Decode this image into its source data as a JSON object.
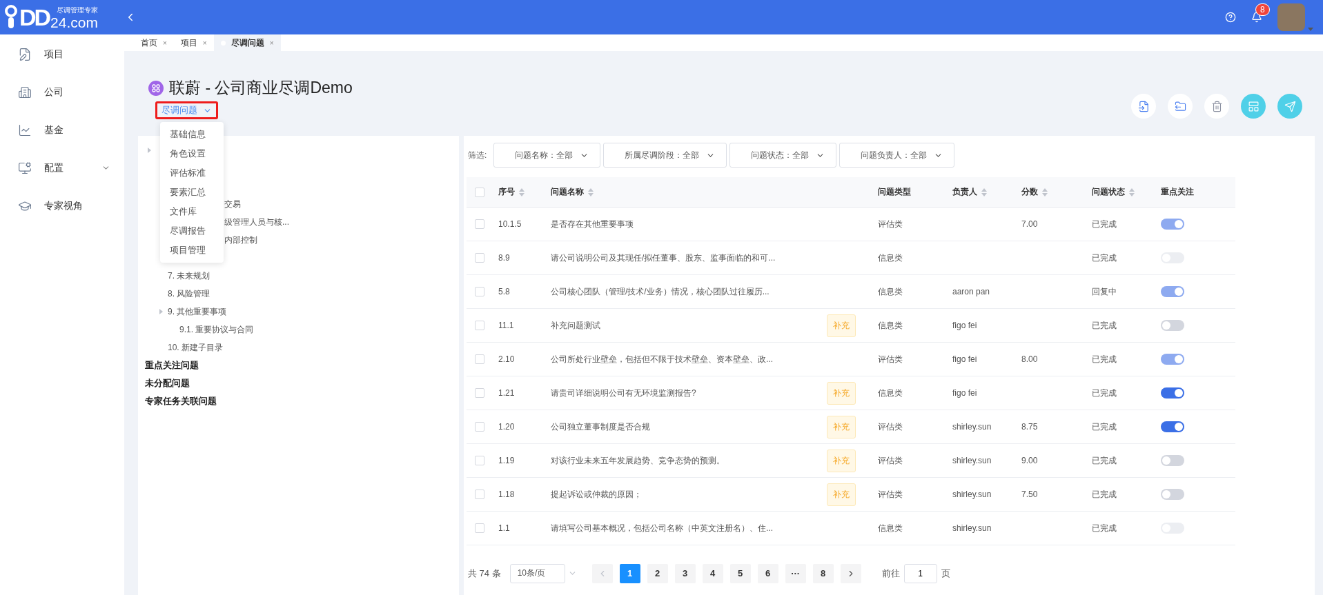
{
  "topbar": {
    "logo": {
      "mark": "DD",
      "suffix": "24.com",
      "tagline": "尽调管理专家"
    },
    "notifications": "8"
  },
  "sidebar": {
    "items": [
      {
        "label": "项目",
        "expandable": false
      },
      {
        "label": "公司",
        "expandable": false
      },
      {
        "label": "基金",
        "expandable": false
      },
      {
        "label": "配置",
        "expandable": true
      },
      {
        "label": "专家视角",
        "expandable": false
      }
    ]
  },
  "tabs": [
    {
      "label": "首页",
      "close": "×",
      "selected": false
    },
    {
      "label": "项目",
      "close": "×",
      "selected": false
    },
    {
      "label": "尽调问题",
      "close": "×",
      "selected": true
    }
  ],
  "header": {
    "title": "联蔚 - 公司商业尽调Demo",
    "section": "尽调问题",
    "section_highlighted": true,
    "actions": [
      {
        "kind": "import"
      },
      {
        "kind": "export"
      },
      {
        "kind": "delete"
      },
      {
        "kind": "add"
      },
      {
        "kind": "send"
      }
    ]
  },
  "section_menu": [
    "基础信息",
    "角色设置",
    "评估标准",
    "要素汇总",
    "文件库",
    "尽调报告",
    "项目管理"
  ],
  "tree": {
    "items": [
      {
        "children": [
          {
            "kind": "covered"
          },
          {
            "kind": "covered"
          },
          {
            "kind": "covered",
            "label": "交易"
          },
          {
            "kind": "covered",
            "label": "级管理人员与核..."
          },
          {
            "kind": "covered",
            "label": "内部控制"
          },
          {
            "kind": "covered"
          },
          {
            "label": "7. 未来规划"
          },
          {
            "label": "8. 风险管理"
          },
          {
            "label": "9. 其他重要事项",
            "children": [
              {
                "label": "9.1. 重要协议与合同"
              }
            ]
          },
          {
            "label": "10. 新建子目录"
          }
        ]
      },
      {
        "label": "重点关注问题",
        "kind": "group"
      },
      {
        "label": "未分配问题",
        "kind": "group"
      },
      {
        "label": "专家任务关联问题",
        "kind": "group"
      }
    ]
  },
  "filters": {
    "label": "筛选:",
    "items": [
      "问题名称：全部",
      "所属尽调阶段：全部",
      "问题状态：全部",
      "问题负责人：全部"
    ]
  },
  "table": {
    "all_checked": false,
    "columns": [
      {
        "label": "序号",
        "sortable": true
      },
      {
        "label": "问题名称",
        "sortable": true
      },
      {
        "label": "问题类型",
        "sortable": false
      },
      {
        "label": "负责人",
        "sortable": true
      },
      {
        "label": "分数",
        "sortable": true
      },
      {
        "label": "问题状态",
        "sortable": true
      },
      {
        "label": "重点关注",
        "sortable": false
      }
    ],
    "rows": [
      {
        "checked": false,
        "no": "10.1.5",
        "name": "是否存在其他重要事项",
        "type": "评估类",
        "owner": "",
        "score": "7.00",
        "status": "已完成",
        "focus_on": true,
        "focus_disabled": true
      },
      {
        "checked": false,
        "no": "8.9",
        "name": "请公司说明公司及其现任/拟任董事、股东、监事面临的和可...",
        "type": "信息类",
        "owner": "",
        "score": "",
        "status": "已完成",
        "focus_on": false,
        "focus_disabled": true
      },
      {
        "checked": false,
        "no": "5.8",
        "name": "公司核心团队（管理/技术/业务）情况，核心团队过往履历...",
        "type": "信息类",
        "owner": "aaron pan",
        "score": "",
        "status": "回复中",
        "focus_on": true,
        "focus_disabled": true
      },
      {
        "checked": false,
        "no": "11.1",
        "name": "补充问题测试",
        "tag": "补充",
        "type": "信息类",
        "owner": "figo fei",
        "score": "",
        "status": "已完成",
        "focus_on": false,
        "focus_disabled": false
      },
      {
        "checked": false,
        "no": "2.10",
        "name": "公司所处行业壁垒，包括但不限于技术壁垒、资本壁垒、政...",
        "type": "评估类",
        "owner": "figo fei",
        "score": "8.00",
        "status": "已完成",
        "focus_on": true,
        "focus_disabled": true
      },
      {
        "checked": false,
        "no": "1.21",
        "name": "请贵司详细说明公司有无环境监测报告?",
        "tag": "补充",
        "type": "信息类",
        "owner": "figo fei",
        "score": "",
        "status": "已完成",
        "focus_on": true,
        "focus_disabled": false
      },
      {
        "checked": false,
        "no": "1.20",
        "name": "公司独立董事制度是否合规",
        "tag": "补充",
        "type": "评估类",
        "owner": "shirley.sun",
        "score": "8.75",
        "status": "已完成",
        "focus_on": true,
        "focus_disabled": false
      },
      {
        "checked": false,
        "no": "1.19",
        "name": "对该行业未来五年发展趋势、竞争态势的预测。",
        "tag": "补充",
        "type": "评估类",
        "owner": "shirley.sun",
        "score": "9.00",
        "status": "已完成",
        "focus_on": false,
        "focus_disabled": false
      },
      {
        "checked": false,
        "no": "1.18",
        "name": "提起诉讼或仲裁的原因；",
        "tag": "补充",
        "type": "评估类",
        "owner": "shirley.sun",
        "score": "7.50",
        "status": "已完成",
        "focus_on": false,
        "focus_disabled": false
      },
      {
        "checked": false,
        "no": "1.1",
        "name": "请填写公司基本概况，包括公司名称（中英文注册名）、住...",
        "type": "信息类",
        "owner": "shirley.sun",
        "score": "",
        "status": "已完成",
        "focus_on": false,
        "focus_disabled": true
      }
    ]
  },
  "pagination": {
    "total": "共 74 条",
    "page_size": "10条/页",
    "pages": [
      {
        "label": "1",
        "selected": true
      },
      {
        "label": "2",
        "selected": false
      },
      {
        "label": "3",
        "selected": false
      },
      {
        "label": "4",
        "selected": false
      },
      {
        "label": "5",
        "selected": false
      },
      {
        "label": "6",
        "selected": false
      },
      {
        "label": "···",
        "selected": false
      },
      {
        "label": "8",
        "selected": false
      }
    ],
    "goto_label": "前往",
    "goto_value": "1",
    "goto_suffix": "页"
  }
}
